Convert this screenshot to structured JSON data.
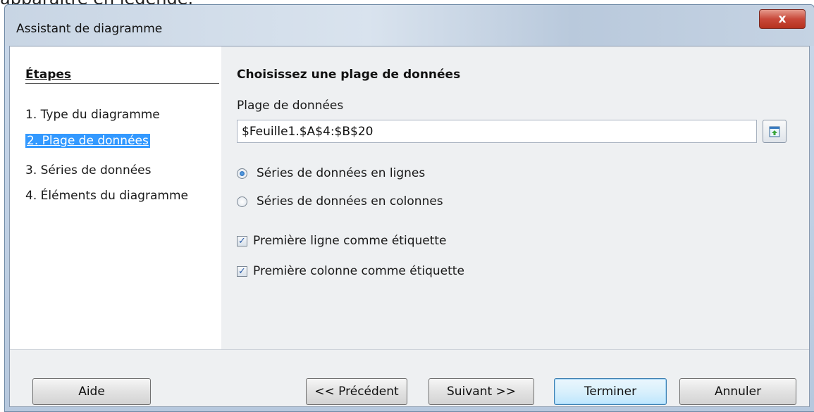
{
  "background": {
    "text": "apparaître en légende."
  },
  "window": {
    "title": "Assistant de diagramme",
    "close_label": "x"
  },
  "sidebar": {
    "heading": "Étapes",
    "steps": [
      {
        "num": "1.",
        "label": "Type du diagramme"
      },
      {
        "num": "2.",
        "label": "Plage de données"
      },
      {
        "num": "3.",
        "label": "Séries de données"
      },
      {
        "num": "4.",
        "label": "Éléments du diagramme"
      }
    ]
  },
  "content": {
    "title": "Choisissez une plage de données",
    "range_label": "Plage de données",
    "range_value": "$Feuille1.$A$4:$B$20",
    "radio_rows": {
      "label": "Séries de données en lignes",
      "checked": true
    },
    "radio_cols": {
      "label": "Séries de données en colonnes",
      "checked": false
    },
    "check_first_row": {
      "label": "Première ligne comme étiquette",
      "checked": true
    },
    "check_first_col": {
      "label": "Première colonne comme étiquette",
      "checked": true
    }
  },
  "buttons": {
    "help": "Aide",
    "previous": "<< Précédent",
    "next": "Suivant >>",
    "finish": "Terminer",
    "cancel": "Annuler"
  },
  "colors": {
    "selection": "#3399ff",
    "close": "#c9493a",
    "panel": "#eef0f2"
  },
  "icons": {
    "range_button": "shrink-range-icon",
    "close": "close-icon"
  }
}
